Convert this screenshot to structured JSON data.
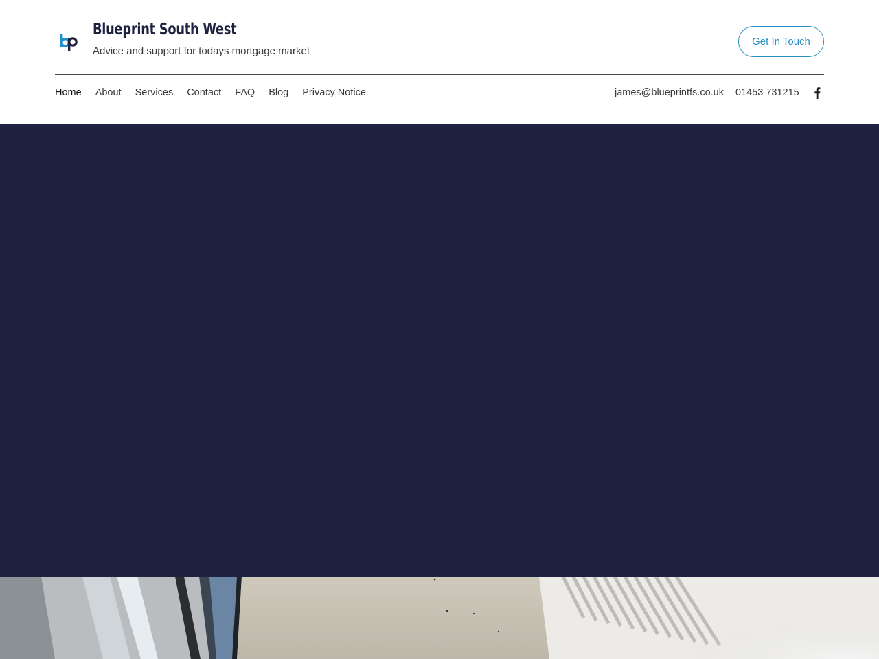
{
  "header": {
    "logo_icon": "bp-logo-icon",
    "title": "Blueprint South West",
    "tagline": "Advice and support for todays mortgage market",
    "cta_label": "Get In Touch"
  },
  "nav": {
    "items": [
      {
        "label": "Home",
        "active": true
      },
      {
        "label": "About"
      },
      {
        "label": "Services"
      },
      {
        "label": "Contact"
      },
      {
        "label": "FAQ"
      },
      {
        "label": "Blog"
      },
      {
        "label": "Privacy Notice"
      }
    ]
  },
  "contact": {
    "email": "james@blueprintfs.co.uk",
    "phone": "01453 731215",
    "social_icon": "facebook-icon"
  },
  "colors": {
    "brand_navy": "#1e2140",
    "accent_blue": "#2a8fc7"
  },
  "hero": {
    "image": "stairwell-photo"
  }
}
